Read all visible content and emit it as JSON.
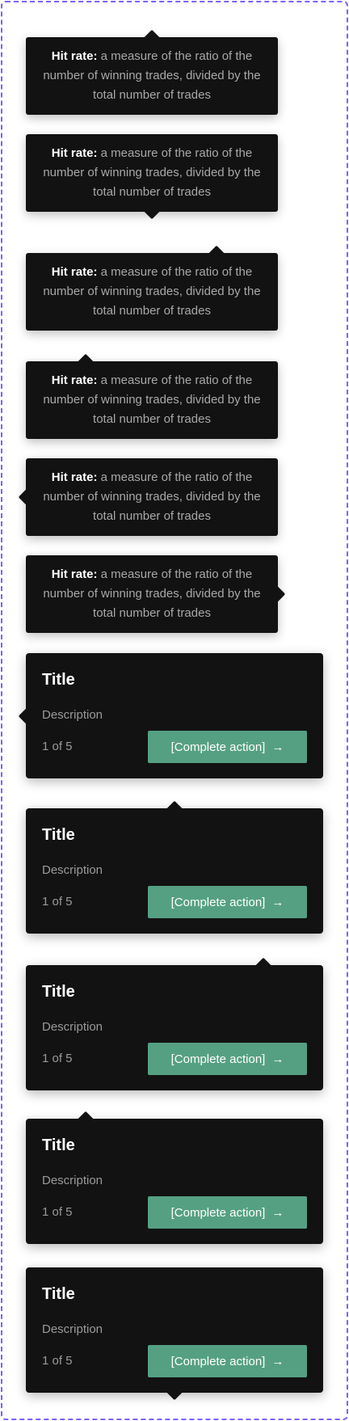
{
  "tooltip": {
    "term": "Hit rate:",
    "definition": " a measure of the ratio of the number of winning trades, divided by the total number of trades"
  },
  "card": {
    "title": "Title",
    "description": "Description",
    "step": "1 of 5",
    "action_label": "[Complete action]",
    "action_icon": "arrow-right-icon"
  },
  "colors": {
    "background": "#121212",
    "accent": "#55a083",
    "frame": "#7b61ff"
  }
}
